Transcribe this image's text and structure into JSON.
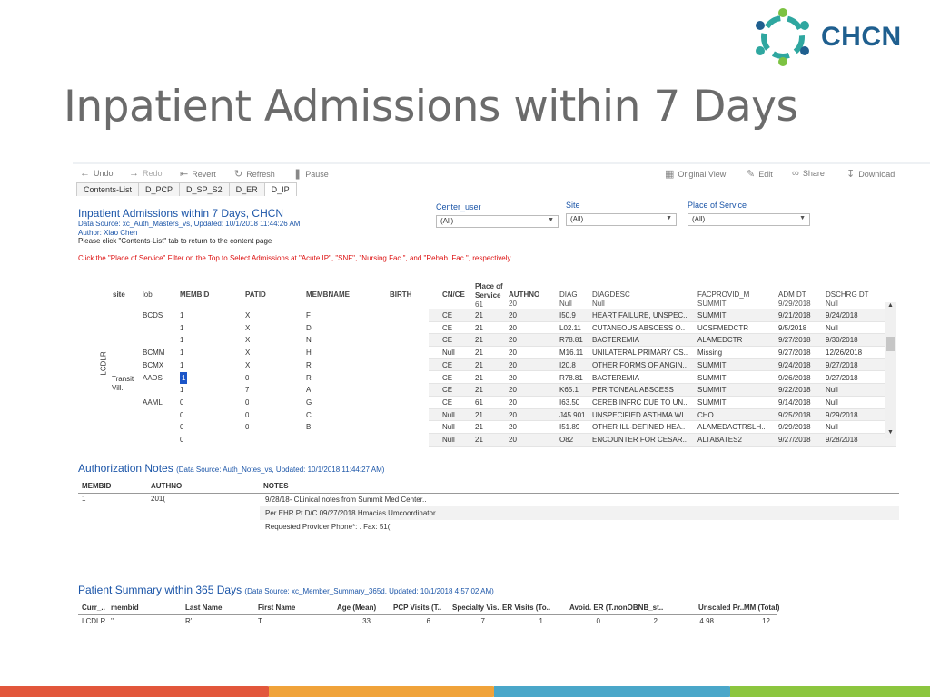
{
  "slide": {
    "title": "Inpatient Admissions within 7 Days",
    "logo_text": "CHCN",
    "colors": {
      "logo_blue": "#1f5f8f",
      "logo_teal": "#2fa7a0",
      "logo_green": "#7cc242",
      "stripe": [
        "#e2573b",
        "#f0a33a",
        "#4aa7c9",
        "#8cc63f"
      ]
    }
  },
  "toolbar": {
    "undo": "Undo",
    "redo": "Redo",
    "revert": "Revert",
    "refresh": "Refresh",
    "pause": "Pause",
    "original_view": "Original View",
    "edit": "Edit",
    "share": "Share",
    "download": "Download"
  },
  "tabs": [
    "Contents-List",
    "D_PCP",
    "D_SP_S2",
    "D_ER",
    "D_IP"
  ],
  "header": {
    "title": "Inpatient Admissions within 7 Days, CHCN",
    "source": "Data Source: xc_Auth_Masters_vs, Updated: 10/1/2018 11:44:26 AM",
    "author": "Author: Xiao Chen",
    "contents_note": "Please click \"Contents-List\" tab to return to the content page",
    "instruction": "Click the \"Place of Service\" Filter on the Top to Select Admissions at \"Acute IP\", \"SNF\", \"Nursing Fac.\", and \"Rehab. Fac.\", respectively"
  },
  "filters": [
    {
      "label": "Center_user",
      "value": "(All)"
    },
    {
      "label": "Site",
      "value": "(All)"
    },
    {
      "label": "Place of Service",
      "value": "(All)"
    }
  ],
  "admissions": {
    "columns": {
      "site": "site",
      "lob": "lob",
      "membid": "MEMBID",
      "patid": "PATID",
      "membname": "MEMBNAME",
      "birth": "BIRTH",
      "cnce": "CN/CE",
      "pos": "Place of Service",
      "pos_sub": "61",
      "authno": "AUTHNO",
      "authno_sub": "20",
      "diag": "DIAG",
      "diag_sub": "Null",
      "diagdesc": "DIAGDESC",
      "diagdesc_sub": "Null",
      "facprovid": "FACPROVID_M",
      "facprovid_sub": "SUMMIT",
      "admdt": "ADM DT",
      "admdt_sub": "9/29/2018",
      "dschrg": "DSCHRG DT",
      "dschrg_sub": "Null"
    },
    "group_label": "LCDLR",
    "site_labels": [
      "Transit",
      "Vill."
    ],
    "rows": [
      {
        "lob": "BCDS",
        "membid": "1",
        "patid": "X",
        "name": "F",
        "cnce": "CE",
        "pos": "21",
        "authno": "20",
        "diag": "I50.9",
        "desc": "HEART FAILURE, UNSPEC..",
        "fac": "SUMMIT",
        "adm": "9/21/2018",
        "dsc": "9/24/2018"
      },
      {
        "lob": "",
        "membid": "1",
        "patid": "X",
        "name": "D",
        "cnce": "CE",
        "pos": "21",
        "authno": "20",
        "diag": "L02.11",
        "desc": "CUTANEOUS ABSCESS O..",
        "fac": "UCSFMEDCTR",
        "adm": "9/5/2018",
        "dsc": "Null"
      },
      {
        "lob": "",
        "membid": "1",
        "patid": "X",
        "name": "N",
        "cnce": "CE",
        "pos": "21",
        "authno": "20",
        "diag": "R78.81",
        "desc": "BACTEREMIA",
        "fac": "ALAMEDCTR",
        "adm": "9/27/2018",
        "dsc": "9/30/2018"
      },
      {
        "lob": "BCMM",
        "membid": "1",
        "patid": "X",
        "name": "H",
        "cnce": "Null",
        "pos": "21",
        "authno": "20",
        "diag": "M16.11",
        "desc": "UNILATERAL PRIMARY OS..",
        "fac": "Missing",
        "adm": "9/27/2018",
        "dsc": "12/26/2018"
      },
      {
        "lob": "BCMX",
        "membid": "1",
        "patid": "X",
        "name": "R",
        "cnce": "CE",
        "pos": "21",
        "authno": "20",
        "diag": "I20.8",
        "desc": "OTHER FORMS OF ANGIN..",
        "fac": "SUMMIT",
        "adm": "9/24/2018",
        "dsc": "9/27/2018"
      },
      {
        "lob": "AADS",
        "membid": "1",
        "patid": "0",
        "name": "R",
        "cnce": "CE",
        "pos": "21",
        "authno": "20",
        "diag": "R78.81",
        "desc": "BACTEREMIA",
        "fac": "SUMMIT",
        "adm": "9/26/2018",
        "dsc": "9/27/2018"
      },
      {
        "lob": "",
        "membid": "1",
        "patid": "7",
        "name": "A",
        "cnce": "CE",
        "pos": "21",
        "authno": "20",
        "diag": "K65.1",
        "desc": "PERITONEAL ABSCESS",
        "fac": "SUMMIT",
        "adm": "9/22/2018",
        "dsc": "Null"
      },
      {
        "lob": "AAML",
        "membid": "0",
        "patid": "0",
        "name": "G",
        "cnce": "CE",
        "pos": "61",
        "authno": "20",
        "diag": "I63.50",
        "desc": "CEREB INFRC DUE TO UN..",
        "fac": "SUMMIT",
        "adm": "9/14/2018",
        "dsc": "Null"
      },
      {
        "lob": "",
        "membid": "0",
        "patid": "0",
        "name": "C",
        "cnce": "Null",
        "pos": "21",
        "authno": "20",
        "diag": "J45.901",
        "desc": "UNSPECIFIED ASTHMA WI..",
        "fac": "CHO",
        "adm": "9/25/2018",
        "dsc": "9/29/2018"
      },
      {
        "lob": "",
        "membid": "0",
        "patid": "0",
        "name": "B",
        "cnce": "Null",
        "pos": "21",
        "authno": "20",
        "diag": "I51.89",
        "desc": "OTHER ILL-DEFINED HEA..",
        "fac": "ALAMEDACTRSLH..",
        "adm": "9/29/2018",
        "dsc": "Null"
      },
      {
        "lob": "",
        "membid": "0",
        "patid": "",
        "name": "",
        "cnce": "Null",
        "pos": "21",
        "authno": "20",
        "diag": "O82",
        "desc": "ENCOUNTER FOR CESAR..",
        "fac": "ALTABATES2",
        "adm": "9/27/2018",
        "dsc": "9/28/2018"
      }
    ]
  },
  "auth_notes": {
    "title": "Authorization Notes",
    "source": "(Data Source: Auth_Notes_vs, Updated: 10/1/2018 11:44:27 AM)",
    "columns": {
      "membid": "MEMBID",
      "authno": "AUTHNO",
      "notes": "NOTES"
    },
    "membid": "1",
    "authno": "201(",
    "notes": [
      "9/28/18- CLinical notes from Summit Med Center..",
      "Per EHR Pt D/C 09/27/2018  Hmacias Umcoordinator",
      "Requested Provider Phone*: . Fax: 51("
    ]
  },
  "patient_summary": {
    "title": "Patient Summary within 365 Days",
    "source": "(Data Source: xc_Member_Summary_365d, Updated: 10/1/2018 4:57:02 AM)",
    "columns": [
      "Curr_..",
      "membid",
      "Last Name",
      "First Name",
      "Age (Mean)",
      "PCP Visits (T..",
      "Specialty Vis..",
      "ER Visits (To..",
      "Avoid. ER (T..",
      "nonOBNB_st..",
      "Unscaled Pr..",
      "MM (Total)"
    ],
    "values": [
      "LCDLR",
      "''",
      "R'",
      "T",
      "33",
      "6",
      "7",
      "1",
      "0",
      "2",
      "4.98",
      "12"
    ]
  }
}
